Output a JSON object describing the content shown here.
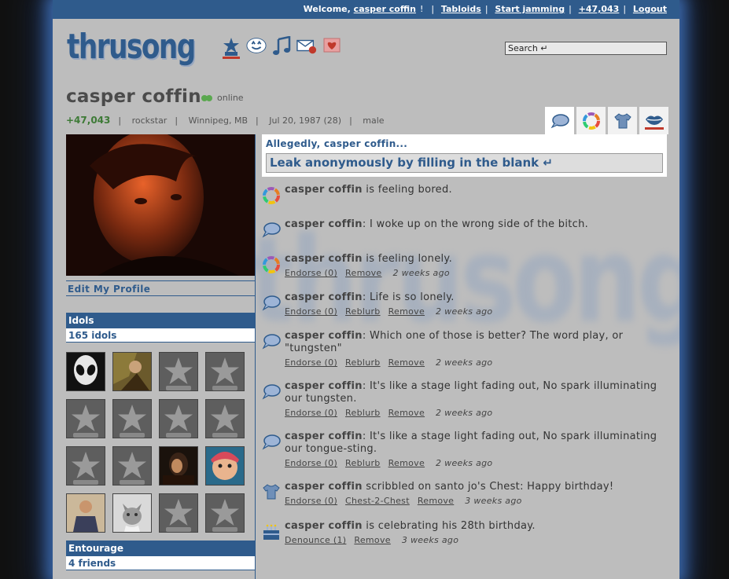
{
  "topbar": {
    "welcome_prefix": "Welcome,",
    "username": "casper coffin",
    "links": [
      "Tabloids",
      "Start jamming",
      "+47,043",
      "Logout"
    ]
  },
  "brand": {
    "logo": "thrusong"
  },
  "nav_icons": [
    "idol-star-icon",
    "face-icon",
    "music-note-icon",
    "mail-icon",
    "heart-book-icon"
  ],
  "search": {
    "value": "Search ↵"
  },
  "profile": {
    "name": "casper coffin",
    "status": "online",
    "score": "+47,043",
    "role": "rockstar",
    "location": "Winnipeg, MB",
    "birthday": "Jul 20, 1987 (28)",
    "gender": "male",
    "edit_link": "Edit My Profile"
  },
  "tabs": [
    "speech-bubble-icon",
    "color-wheel-icon",
    "tshirt-icon",
    "lips-icon"
  ],
  "sidebar": {
    "idols_title": "Idols",
    "idols_count": "165 idols",
    "entourage_title": "Entourage",
    "entourage_count": "4 friends",
    "idols": [
      "alien",
      "guitarist",
      "star",
      "star",
      "star",
      "star",
      "star",
      "star",
      "star",
      "star",
      "dark-haired",
      "baby",
      "man-in-sweater",
      "kitten",
      "star",
      "star"
    ]
  },
  "allegedly": {
    "title": "Allegedly, casper coffin...",
    "placeholder": "Leak anonymously by filling in the blank ↵"
  },
  "feed": [
    {
      "icon": "color-wheel-icon",
      "who": "casper coffin",
      "text": " is feeling bored.",
      "actions": [],
      "ago": ""
    },
    {
      "icon": "speech-bubble-icon",
      "who": "casper coffin",
      "text": ": I woke up on the wrong side of the bitch.",
      "actions": [],
      "ago": ""
    },
    {
      "icon": "color-wheel-icon",
      "who": "casper coffin",
      "text": " is feeling lonely.",
      "actions": [
        "Endorse (0)",
        "Remove"
      ],
      "ago": "2 weeks ago"
    },
    {
      "icon": "speech-bubble-icon",
      "who": "casper coffin",
      "text": ": Life is so lonely.",
      "actions": [
        "Endorse (0)",
        "Reblurb",
        "Remove"
      ],
      "ago": "2 weeks ago"
    },
    {
      "icon": "speech-bubble-icon",
      "who": "casper coffin",
      "text": ": Which one of those is better? The word play, or \"tungsten\"",
      "actions": [
        "Endorse (0)",
        "Reblurb",
        "Remove"
      ],
      "ago": "2 weeks ago"
    },
    {
      "icon": "speech-bubble-icon",
      "who": "casper coffin",
      "text": ": It's like a stage light fading out, No spark illuminating our tungsten.",
      "actions": [
        "Endorse (0)",
        "Reblurb",
        "Remove"
      ],
      "ago": "2 weeks ago"
    },
    {
      "icon": "speech-bubble-icon",
      "who": "casper coffin",
      "text": ": It's like a stage light fading out, No spark illuminating our tongue-sting.",
      "actions": [
        "Endorse (0)",
        "Reblurb",
        "Remove"
      ],
      "ago": "2 weeks ago"
    },
    {
      "icon": "tshirt-icon",
      "who": "casper coffin",
      "text": " scribbled on santo jo's Chest: Happy birthday!",
      "actions": [
        "Endorse (0)",
        "Chest-2-Chest",
        "Remove"
      ],
      "ago": "3 weeks ago"
    },
    {
      "icon": "cake-icon",
      "who": "casper coffin",
      "text": " is celebrating his 28th birthday.",
      "actions": [
        "Denounce (1)",
        "Remove"
      ],
      "ago": "3 weeks ago"
    }
  ],
  "colors": {
    "brand_blue": "#2f5b8c",
    "page_bg": "#bdbdbd",
    "score_green": "#3d7a36"
  }
}
